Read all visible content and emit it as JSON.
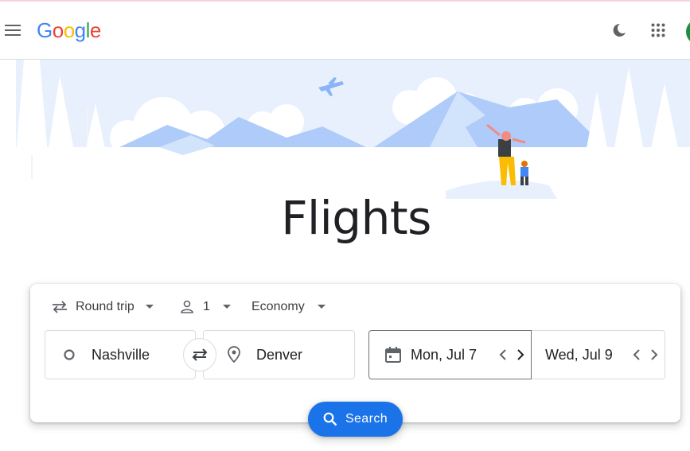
{
  "header": {
    "logo": [
      "G",
      "o",
      "o",
      "g",
      "l",
      "e"
    ],
    "logo_colors": [
      "#4285f4",
      "#ea4335",
      "#fbbc05",
      "#4285f4",
      "#34a853",
      "#ea4335"
    ]
  },
  "page": {
    "title": "Flights"
  },
  "search": {
    "trip_type": "Round trip",
    "passengers": "1",
    "cabin_class": "Economy",
    "origin": "Nashville",
    "destination": "Denver",
    "departure_date": "Mon, Jul 7",
    "return_date": "Wed, Jul 9",
    "search_label": "Search"
  },
  "icons": {
    "menu": "hamburger-menu-icon",
    "theme": "moon-icon",
    "apps": "apps-grid-icon",
    "trip": "swap-arrows-icon",
    "passenger": "person-icon",
    "origin": "circle-icon",
    "destination": "location-pin-icon",
    "date": "calendar-icon",
    "search": "search-icon"
  },
  "colors": {
    "accent": "#1a73e8",
    "hero_sky": "#e8f0fe",
    "hero_mountain": "#aecbfa",
    "avatar": "#1e8e3e"
  }
}
